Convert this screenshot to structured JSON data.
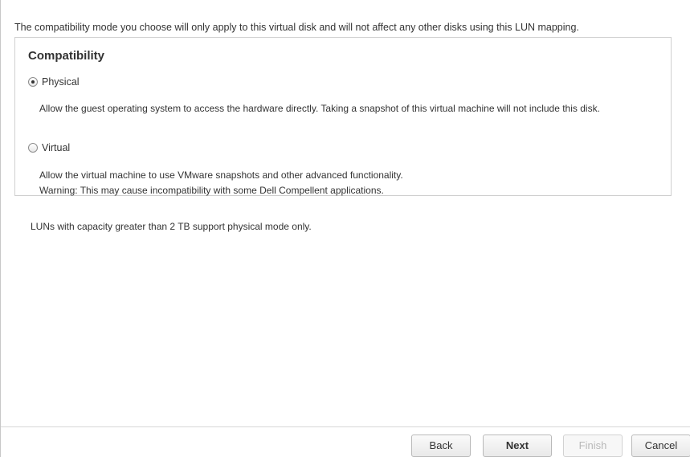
{
  "intro_text": "The compatibility mode you choose will only apply to this virtual disk and will not affect any other disks using this LUN mapping.",
  "compatibility": {
    "title": "Compatibility",
    "selected": "Physical",
    "options": [
      {
        "label": "Physical",
        "checked": true,
        "description": "Allow the guest operating system to access the hardware directly. Taking a snapshot of this virtual machine will not include this disk."
      },
      {
        "label": "Virtual",
        "checked": false,
        "description": "Allow the virtual machine to use VMware snapshots and other advanced functionality.",
        "warning": "Warning: This may cause incompatibility with some Dell Compellent applications."
      }
    ]
  },
  "note": "LUNs with capacity greater than 2 TB support physical mode only.",
  "buttons": {
    "back": "Back",
    "next": "Next",
    "finish": "Finish",
    "cancel": "Cancel"
  }
}
